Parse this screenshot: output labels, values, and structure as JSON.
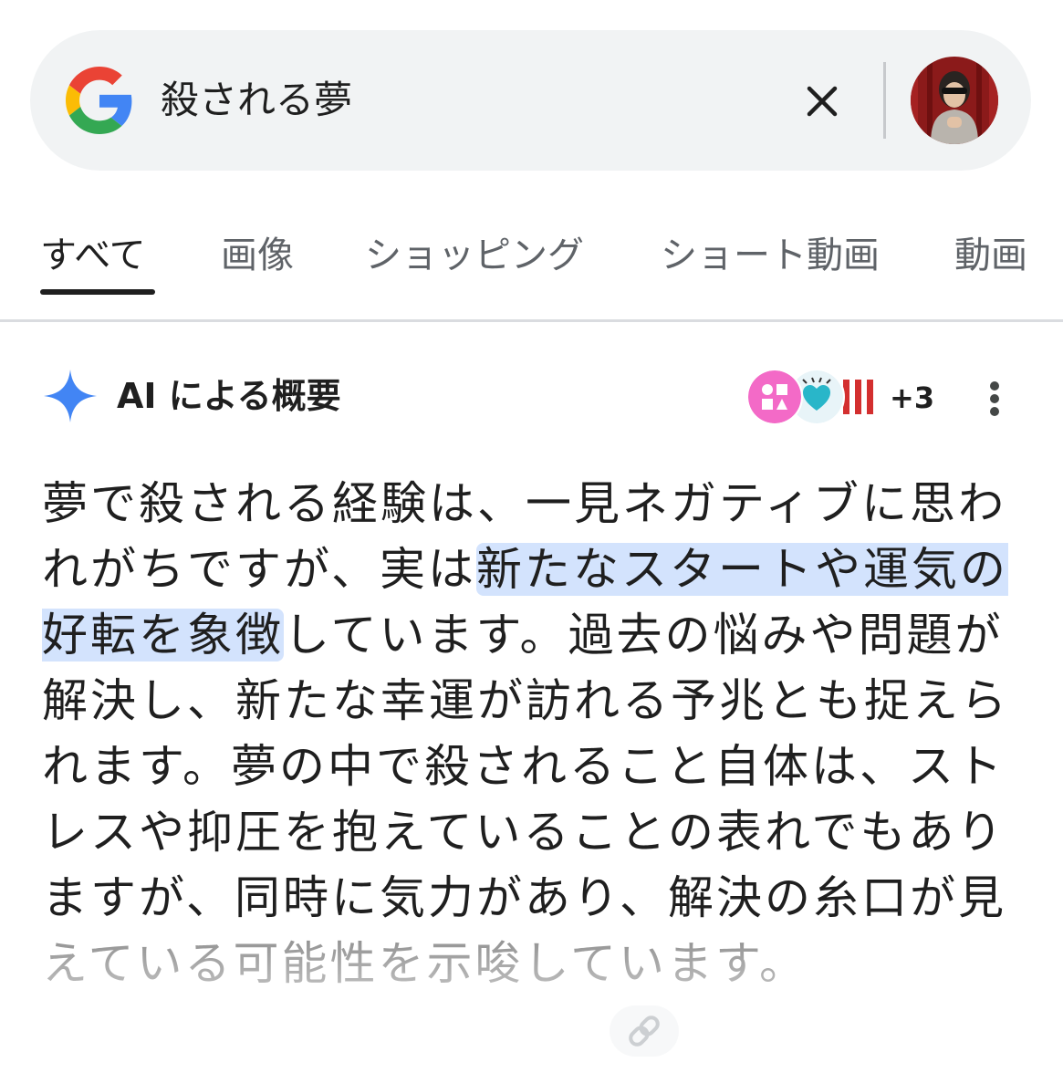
{
  "search": {
    "query": "殺される夢",
    "clear_icon": "close-icon",
    "logo_icon": "google-g-icon"
  },
  "tabs": [
    {
      "label": "すべて",
      "active": true
    },
    {
      "label": "画像",
      "active": false
    },
    {
      "label": "ショッピング",
      "active": false
    },
    {
      "label": "ショート動画",
      "active": false
    },
    {
      "label": "動画",
      "active": false
    }
  ],
  "ai_overview": {
    "title": "AI による概要",
    "icon": "sparkle-icon",
    "sources_more": "+3",
    "menu_icon": "more-vert-icon",
    "body_before": "夢で殺される経験は、一見ネガティブに思われがちですが、実は",
    "body_highlight": "新たなスタートや運気の好転を象徴",
    "body_after": "しています。過去の悩みや問題が解決し、新たな幸運が訪れる予兆とも捉えられます。夢の中で殺されること自体は、ストレスや抑圧を抱えていることの表れでもありますが、同時に気力があり、解決の糸口が見えている可能性を示唆しています。",
    "link_icon": "link-icon"
  },
  "colors": {
    "highlight": "#d3e3fd",
    "sparkle": "#4285f4",
    "search_bg": "#f1f3f4"
  }
}
